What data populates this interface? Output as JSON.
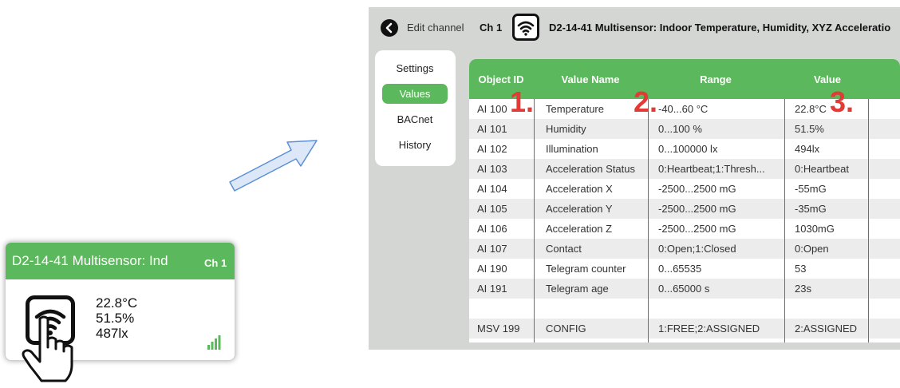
{
  "tile": {
    "title": "D2-14-41 Multisensor: Ind",
    "channel": "Ch 1",
    "values": [
      "22.8°C",
      "51.5%",
      "487lx"
    ]
  },
  "header": {
    "edit_label": "Edit channel",
    "channel": "Ch 1",
    "device_title": "D2-14-41 Multisensor: Indoor Temperature, Humidity, XYZ Acceleratio"
  },
  "tabs": [
    {
      "label": "Settings"
    },
    {
      "label": "Values"
    },
    {
      "label": "BACnet"
    },
    {
      "label": "History"
    }
  ],
  "table": {
    "columns": [
      "Object ID",
      "Value Name",
      "Range",
      "Value"
    ],
    "rows": [
      [
        "AI 100",
        "Temperature",
        "-40...60 °C",
        "22.8°C"
      ],
      [
        "AI 101",
        "Humidity",
        "0...100 %",
        "51.5%"
      ],
      [
        "AI 102",
        "Illumination",
        "0...100000 lx",
        "494lx"
      ],
      [
        "AI 103",
        "Acceleration Status",
        "0:Heartbeat;1:Thresh...",
        "0:Heartbeat"
      ],
      [
        "AI 104",
        "Acceleration X",
        "-2500...2500 mG",
        "-55mG"
      ],
      [
        "AI 105",
        "Acceleration Y",
        "-2500...2500 mG",
        "-35mG"
      ],
      [
        "AI 106",
        "Acceleration Z",
        "-2500...2500 mG",
        "1030mG"
      ],
      [
        "AI 107",
        "Contact",
        "0:Open;1:Closed",
        "0:Open"
      ],
      [
        "AI 190",
        "Telegram counter",
        "0...65535",
        "53"
      ],
      [
        "AI 191",
        "Telegram age",
        "0...65000 s",
        "23s"
      ],
      [
        "",
        "",
        "",
        ""
      ],
      [
        "MSV 199",
        "CONFIG",
        "1:FREE;2:ASSIGNED",
        "2:ASSIGNED"
      ]
    ]
  },
  "annotations": [
    "1.",
    "2.",
    "3."
  ],
  "colors": {
    "accent": "#5cb85c",
    "marker": "#e53935",
    "panel": "#d4d6d4"
  },
  "icons": [
    "wifi-icon",
    "signal-bars-icon",
    "pointing-hand-icon",
    "arrow-icon",
    "back-icon"
  ]
}
